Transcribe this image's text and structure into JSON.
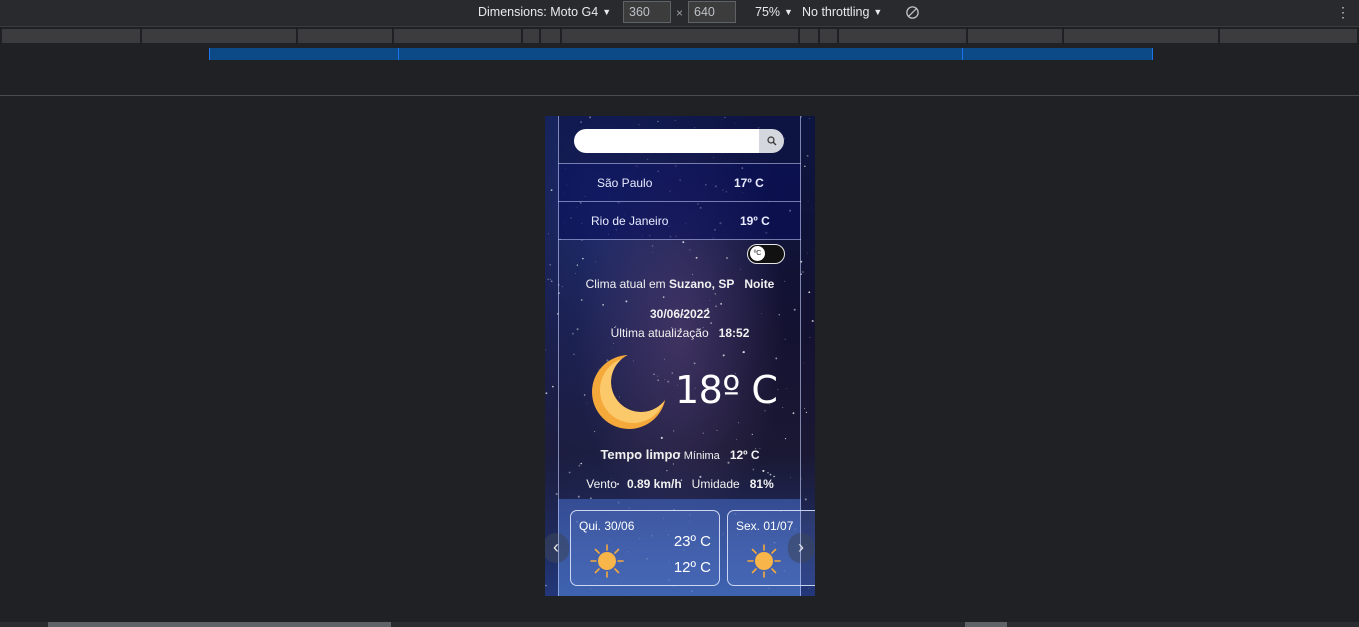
{
  "devtools": {
    "dimensions_label": "Dimensions: Moto G4",
    "width": "360",
    "height": "640",
    "times": "×",
    "zoom": "75%",
    "throttling": "No throttling",
    "icons": [
      "caret-down-icon",
      "rotate-icon",
      "more-vert-icon"
    ]
  },
  "app": {
    "search": {
      "placeholder": "",
      "value": "",
      "icon": "search-icon"
    },
    "saved_cities": [
      {
        "name": "São Paulo",
        "temp": "17º C"
      },
      {
        "name": "Rio de Janeiro",
        "temp": "19º C"
      }
    ],
    "unit_toggle": "ºC",
    "current": {
      "prefix": "Clima atual em",
      "location": "Suzano, SP",
      "period": "Noite",
      "date": "30/06/2022",
      "update_label": "Última atualização",
      "update_time": "18:52",
      "icon": "moon-icon",
      "temperature": "18º C",
      "condition": "Tempo limpo",
      "min_label": "Mínima",
      "min_value": "12º C",
      "wind_label": "Vento",
      "wind_value": "0.89 km/h",
      "humidity_label": "Umidade",
      "humidity_value": "81%"
    },
    "forecast": [
      {
        "date": "Qui. 30/06",
        "max": "23º C",
        "min": "12º C",
        "icon": "sun-icon"
      },
      {
        "date": "Sex. 01/07",
        "max": "",
        "min": "",
        "icon": "sun-icon"
      }
    ],
    "nav": {
      "prev": "‹",
      "next": "›"
    }
  }
}
